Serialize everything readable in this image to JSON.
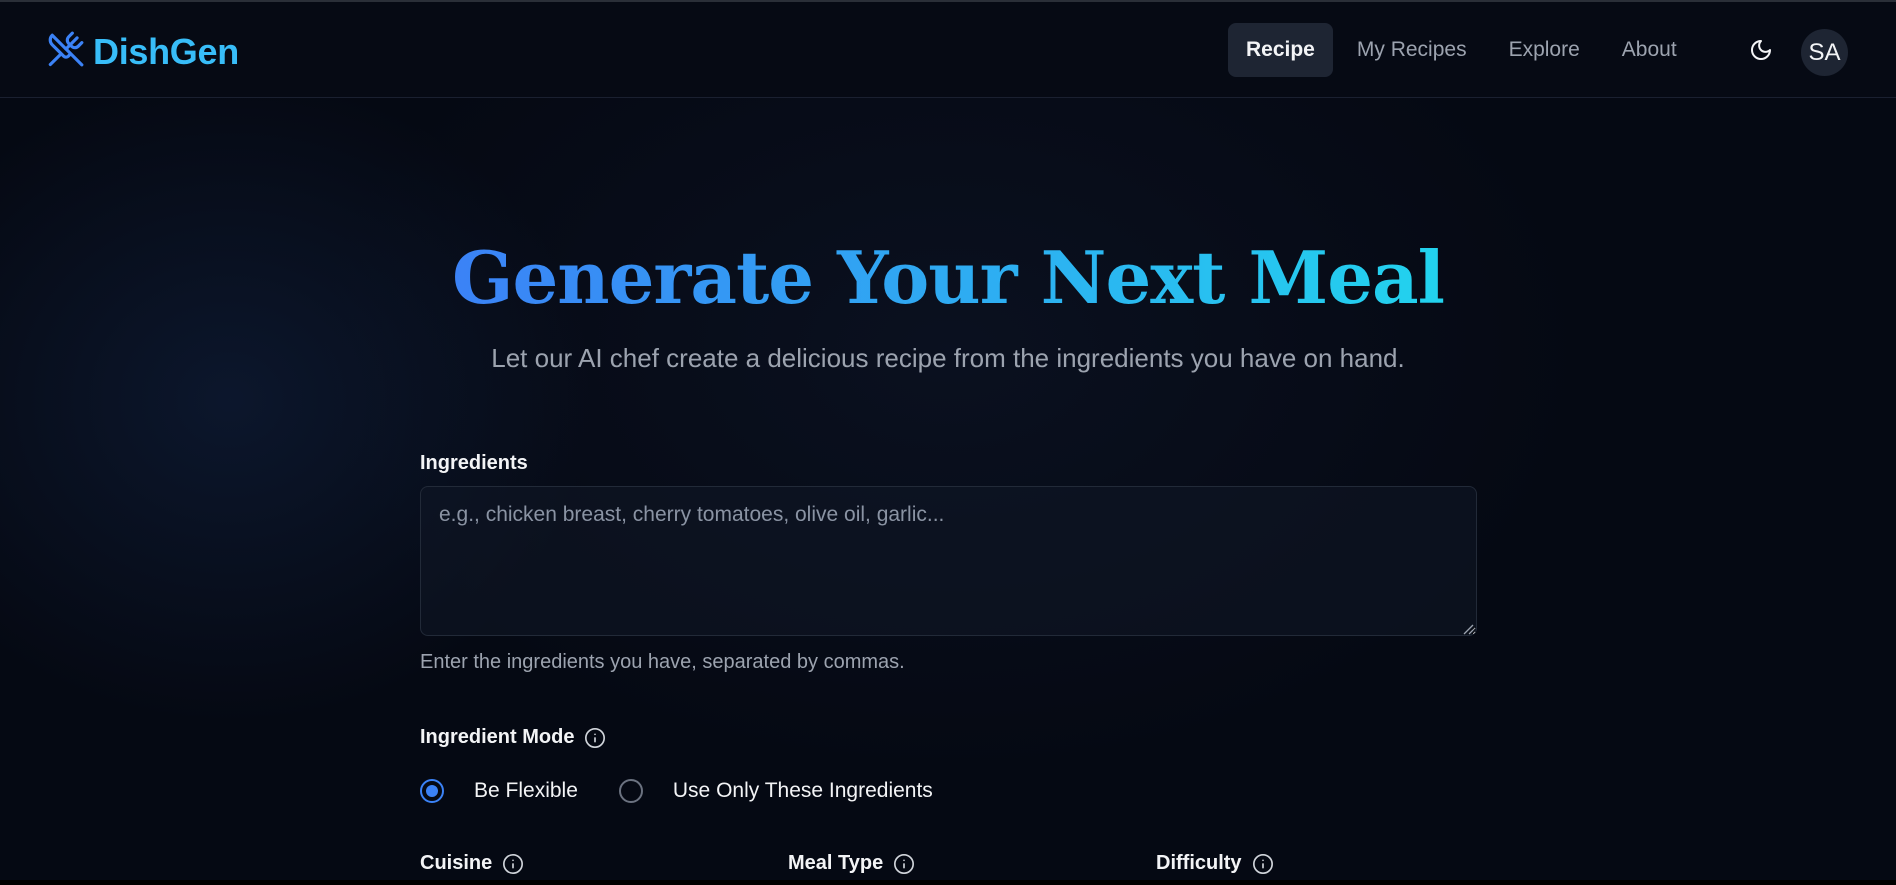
{
  "brand": {
    "name": "DishGen"
  },
  "nav": {
    "items": [
      {
        "label": "Recipe",
        "active": true
      },
      {
        "label": "My Recipes",
        "active": false
      },
      {
        "label": "Explore",
        "active": false
      },
      {
        "label": "About",
        "active": false
      }
    ],
    "theme_icon": "moon-icon",
    "avatar_initials": "SA"
  },
  "hero": {
    "title": "Generate Your Next Meal",
    "subtitle": "Let our AI chef create a delicious recipe from the ingredients you have on hand."
  },
  "form": {
    "ingredients": {
      "label": "Ingredients",
      "placeholder": "e.g., chicken breast, cherry tomatoes, olive oil, garlic...",
      "value": "",
      "hint": "Enter the ingredients you have, separated by commas."
    },
    "mode": {
      "label": "Ingredient Mode",
      "options": [
        {
          "label": "Be Flexible",
          "selected": true
        },
        {
          "label": "Use Only These Ingredients",
          "selected": false
        }
      ]
    },
    "cuisine": {
      "label": "Cuisine"
    },
    "meal_type": {
      "label": "Meal Type"
    },
    "difficulty": {
      "label": "Difficulty"
    }
  },
  "colors": {
    "accent": "#3b82f6",
    "brand": "#38bdf8",
    "gradient_start": "#3b82f6",
    "gradient_end": "#22d3ee"
  }
}
